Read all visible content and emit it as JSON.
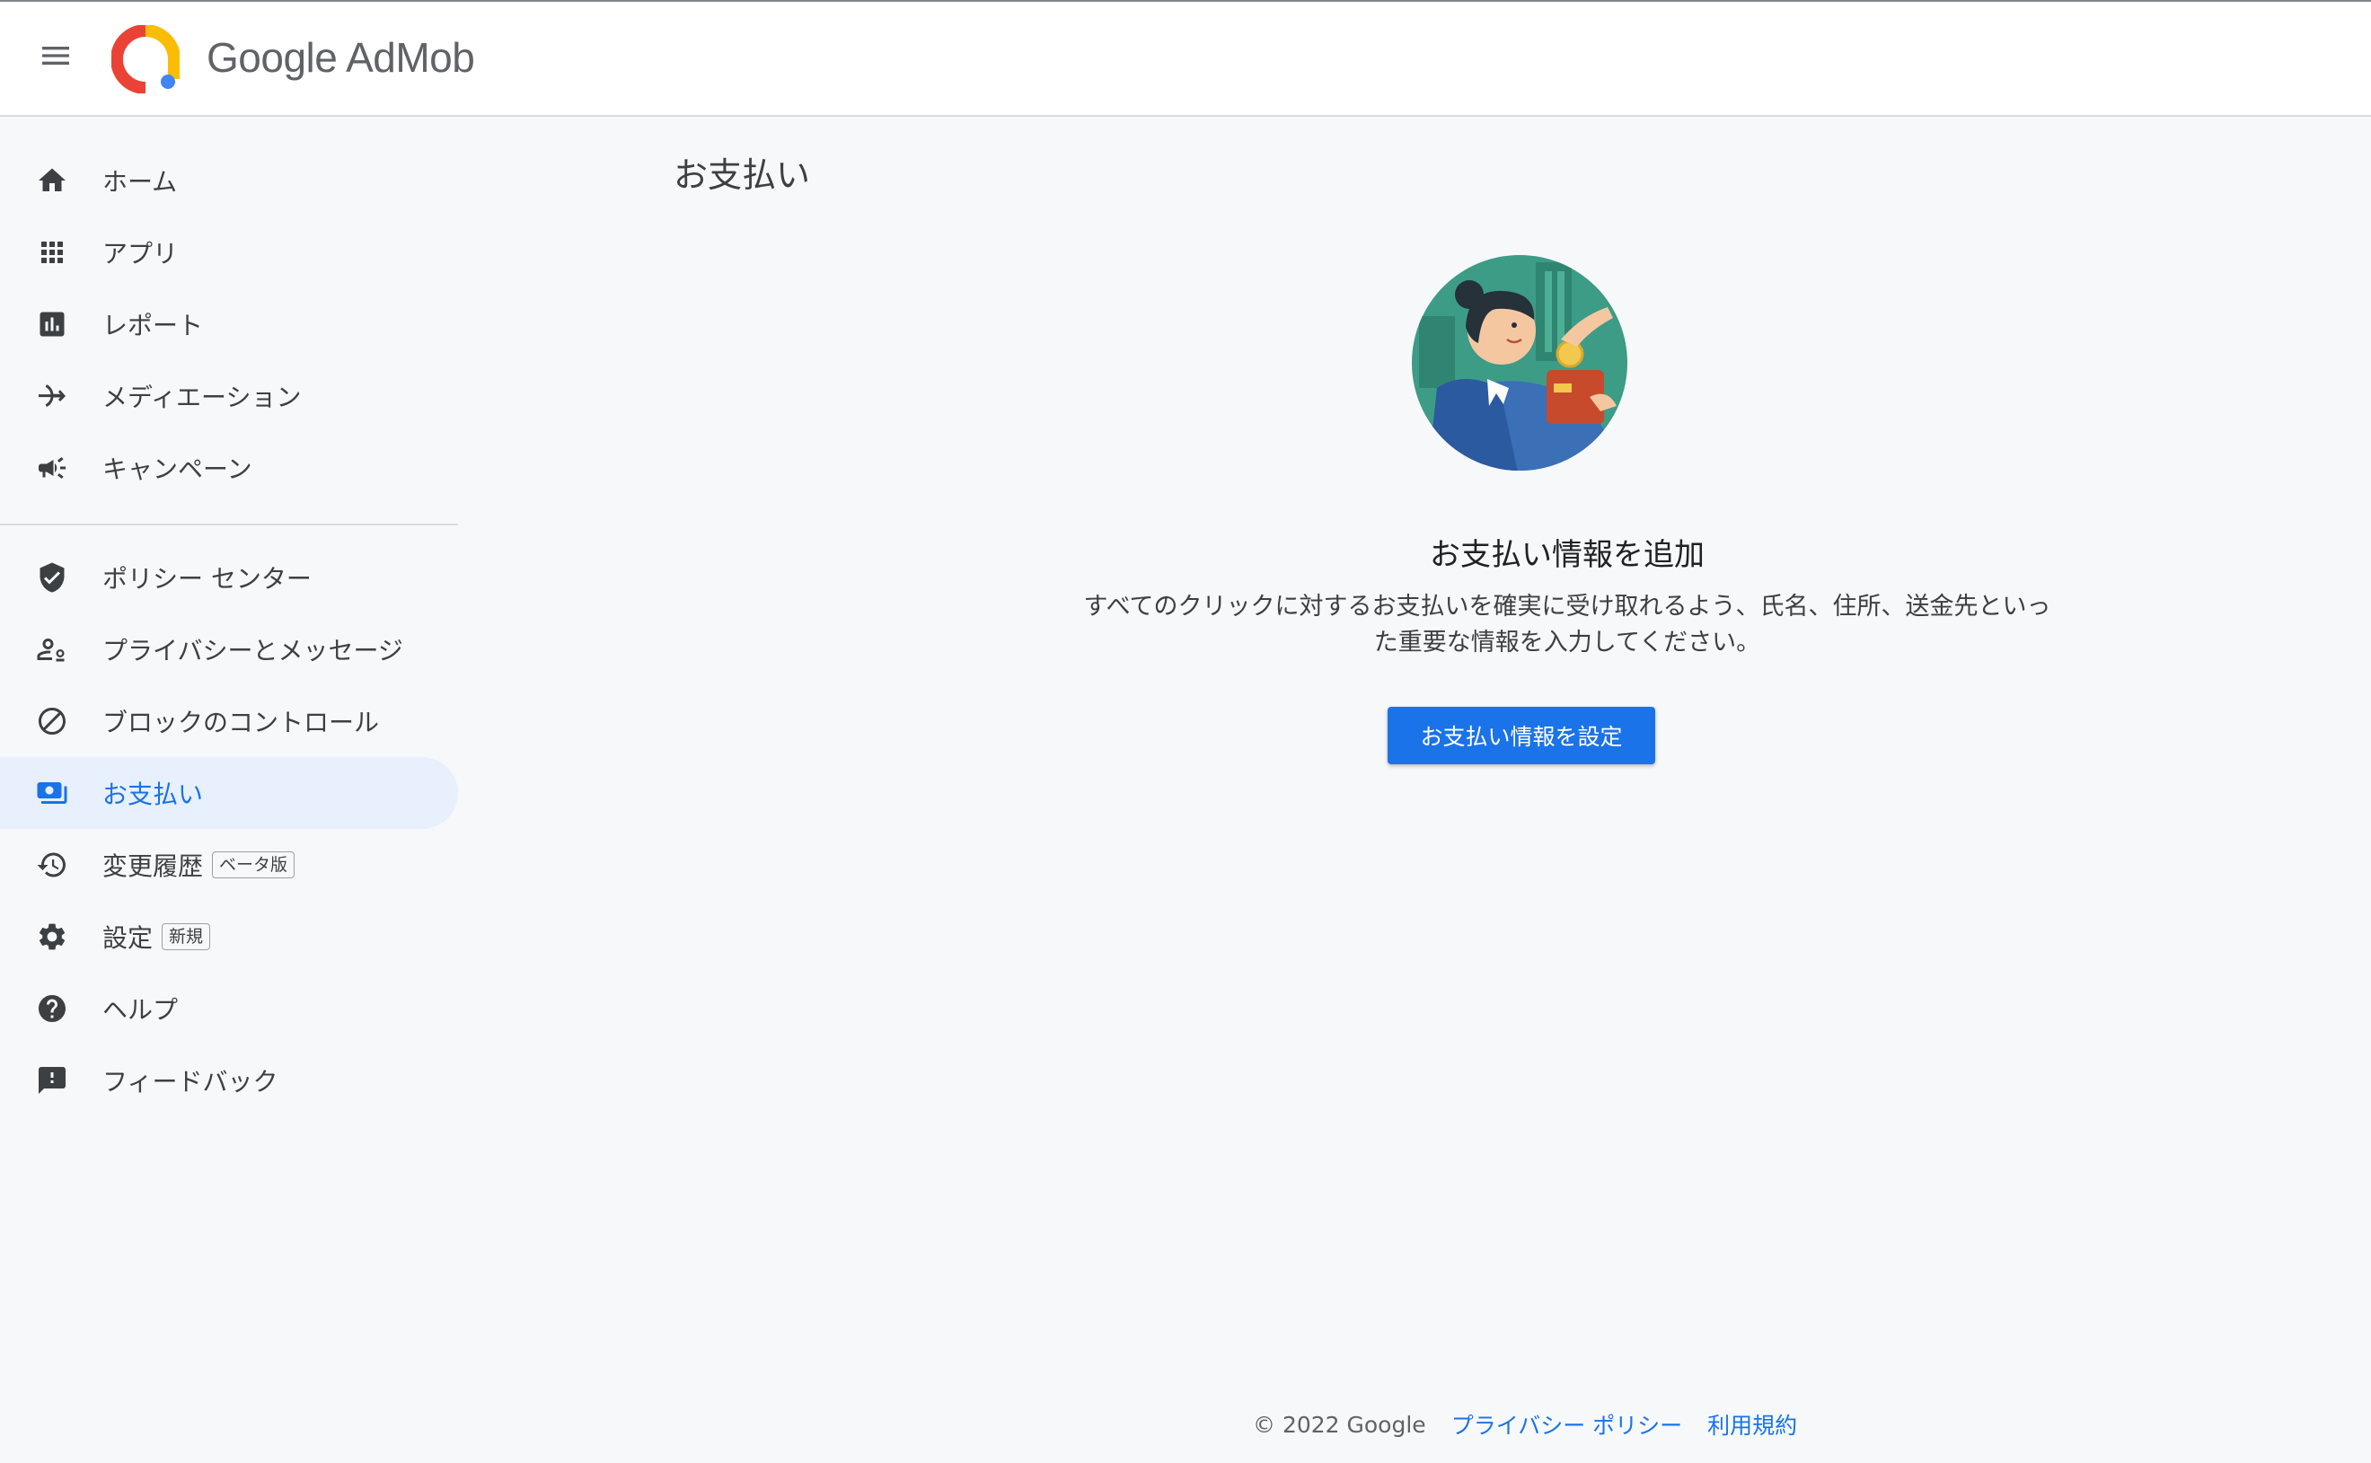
{
  "header": {
    "brand_google": "Google",
    "brand_product": "AdMob"
  },
  "sidebar": {
    "items": [
      {
        "label": "ホーム",
        "icon": "home-icon"
      },
      {
        "label": "アプリ",
        "icon": "apps-grid-icon"
      },
      {
        "label": "レポート",
        "icon": "report-icon"
      },
      {
        "label": "メディエーション",
        "icon": "mediation-icon"
      },
      {
        "label": "キャンペーン",
        "icon": "campaign-megaphone-icon"
      },
      {
        "label": "ポリシー センター",
        "icon": "policy-shield-icon"
      },
      {
        "label": "プライバシーとメッセージ",
        "icon": "privacy-person-icon"
      },
      {
        "label": "ブロックのコントロール",
        "icon": "block-icon"
      },
      {
        "label": "お支払い",
        "icon": "payments-icon",
        "active": true
      },
      {
        "label": "変更履歴",
        "icon": "history-icon",
        "badge": "ベータ版"
      },
      {
        "label": "設定",
        "icon": "settings-gear-icon",
        "badge": "新規"
      },
      {
        "label": "ヘルプ",
        "icon": "help-icon"
      },
      {
        "label": "フィードバック",
        "icon": "feedback-icon"
      }
    ]
  },
  "main": {
    "title": "お支払い",
    "empty_state": {
      "title": "お支払い情報を追加",
      "description": "すべてのクリックに対するお支払いを確実に受け取れるよう、氏名、住所、送金先といった重要な情報を入力してください。",
      "button_label": "お支払い情報を設定"
    }
  },
  "footer": {
    "copyright": "© 2022 Google",
    "privacy_link": "プライバシー ポリシー",
    "terms_link": "利用規約"
  },
  "colors": {
    "accent": "#1a73e8",
    "active_bg": "#e8f0fe",
    "page_bg": "#f7f8fa"
  }
}
